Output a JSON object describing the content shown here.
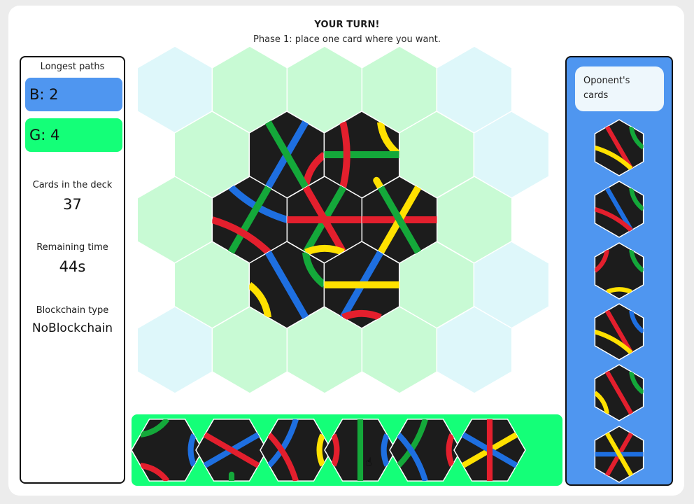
{
  "header": {
    "turn": "YOUR TURN!",
    "phase": "Phase 1: place one card where you want."
  },
  "left_panel": {
    "title": "Longest paths",
    "scores": [
      {
        "label": "B: 2",
        "color": "#4f96f0"
      },
      {
        "label": "G: 4",
        "color": "#14ff78"
      }
    ],
    "deck_label": "Cards in the deck",
    "deck_count": "37",
    "time_label": "Remaining time",
    "time_value": "44s",
    "chain_label": "Blockchain type",
    "chain_value": "NoBlockchain"
  },
  "right_panel": {
    "label": "Oponent's cards",
    "card_count": 6
  },
  "hand": {
    "card_count": 6
  },
  "colors": {
    "blue": "#1e6fe0",
    "green": "#14a83a",
    "red": "#e31f2d",
    "yellow": "#ffe100",
    "tile": "#1c1c1c",
    "empty_green": "#c8fad4",
    "empty_cyan": "#def7fa"
  }
}
